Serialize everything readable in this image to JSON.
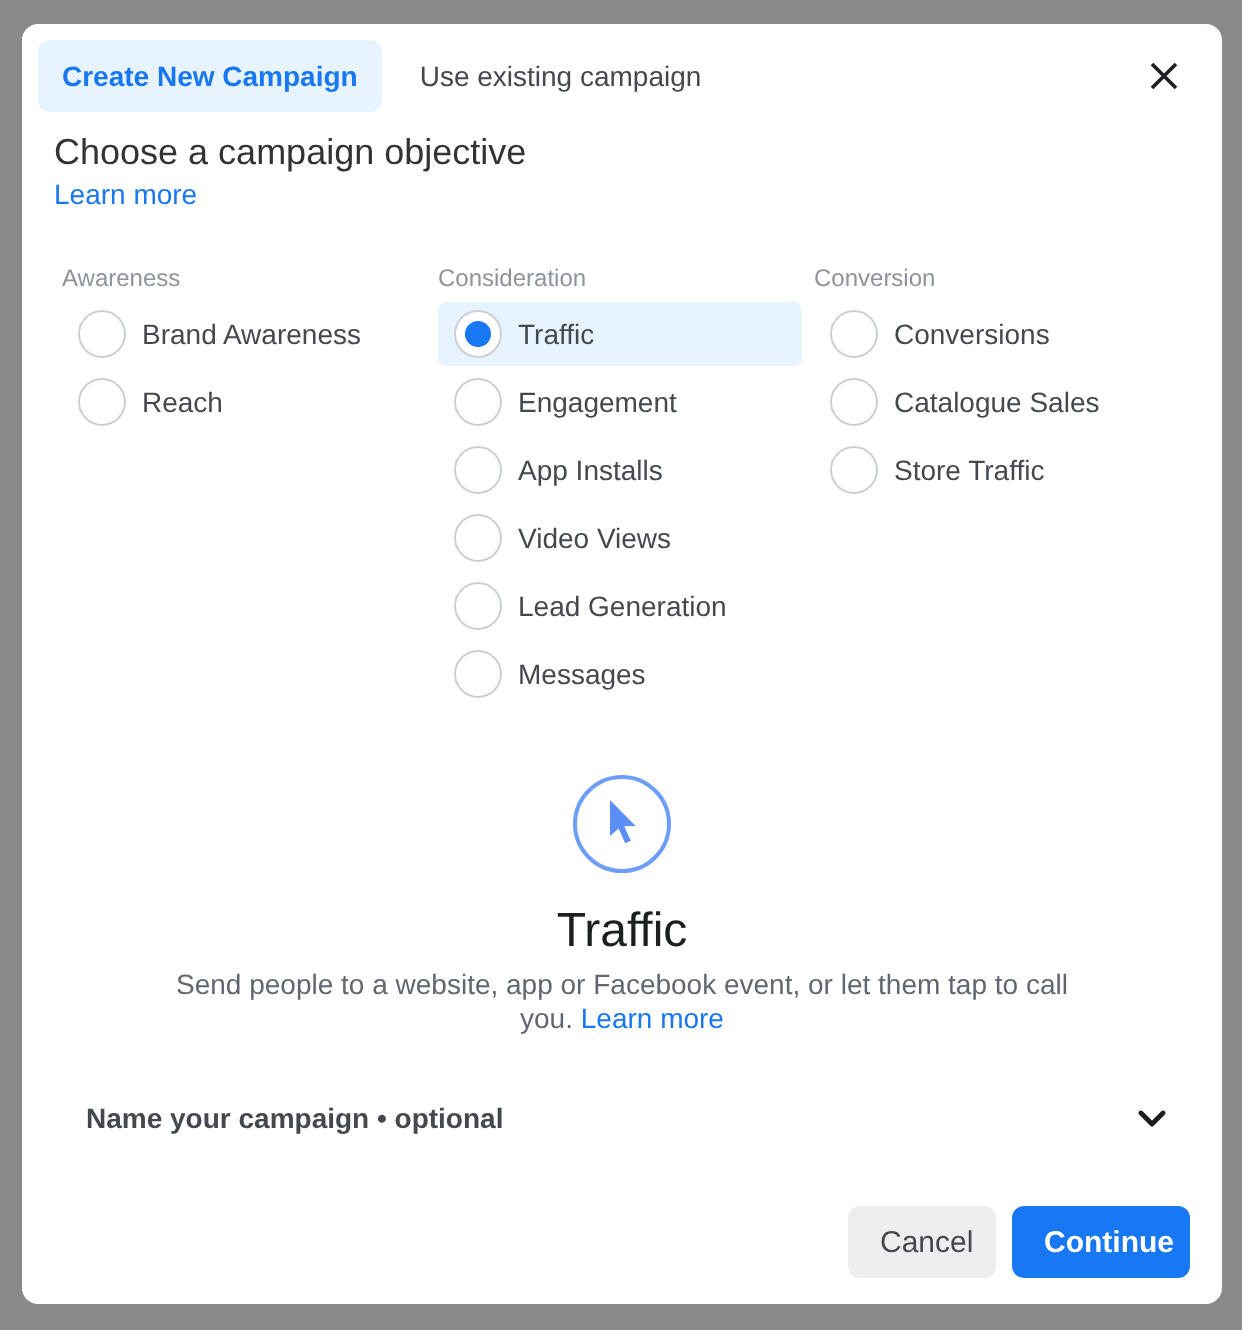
{
  "tabs": [
    {
      "label": "Create New Campaign",
      "selected": true
    },
    {
      "label": "Use existing campaign",
      "selected": false
    }
  ],
  "heading": "Choose a campaign objective",
  "heading_link": "Learn more",
  "objective_groups": [
    {
      "label": "Awareness",
      "options": [
        {
          "label": "Brand Awareness",
          "selected": false
        },
        {
          "label": "Reach",
          "selected": false
        }
      ]
    },
    {
      "label": "Consideration",
      "options": [
        {
          "label": "Traffic",
          "selected": true
        },
        {
          "label": "Engagement",
          "selected": false
        },
        {
          "label": "App Installs",
          "selected": false
        },
        {
          "label": "Video Views",
          "selected": false
        },
        {
          "label": "Lead Generation",
          "selected": false
        },
        {
          "label": "Messages",
          "selected": false
        }
      ]
    },
    {
      "label": "Conversion",
      "options": [
        {
          "label": "Conversions",
          "selected": false
        },
        {
          "label": "Catalogue Sales",
          "selected": false
        },
        {
          "label": "Store Traffic",
          "selected": false
        }
      ]
    }
  ],
  "detail": {
    "title": "Traffic",
    "description": "Send people to a website, app or Facebook event, or let them tap to call you.",
    "link": "Learn more"
  },
  "campaign_name_section": {
    "label": "Name your campaign • optional",
    "expanded": false
  },
  "buttons": [
    {
      "label": "Cancel",
      "kind": "secondary"
    },
    {
      "label": "Continue",
      "kind": "primary"
    }
  ]
}
